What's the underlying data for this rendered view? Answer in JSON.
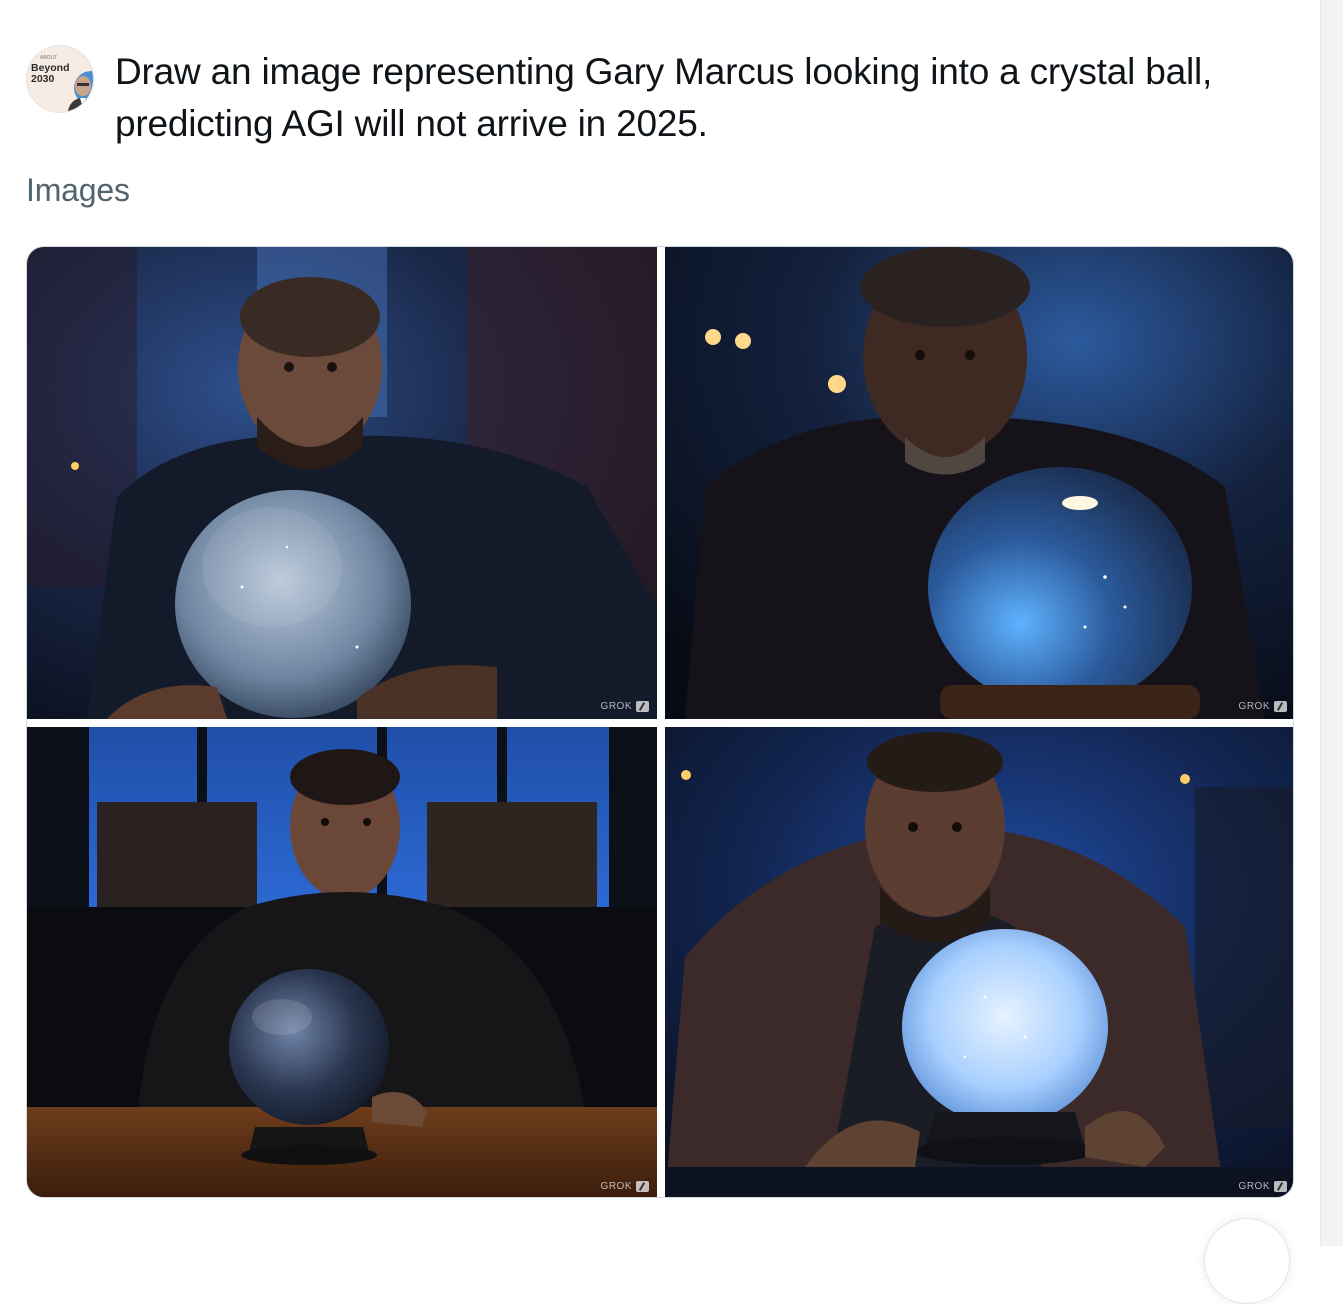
{
  "post": {
    "avatar": {
      "top_text": "ABOUT",
      "line1": "Beyond",
      "line2": "2030"
    },
    "prompt": "Draw an image representing Gary Marcus looking into a crystal ball, predicting AGI will not arrive in 2025."
  },
  "section": {
    "label": "Images"
  },
  "images": [
    {
      "watermark": "GROK"
    },
    {
      "watermark": "GROK"
    },
    {
      "watermark": "GROK"
    },
    {
      "watermark": "GROK"
    }
  ]
}
